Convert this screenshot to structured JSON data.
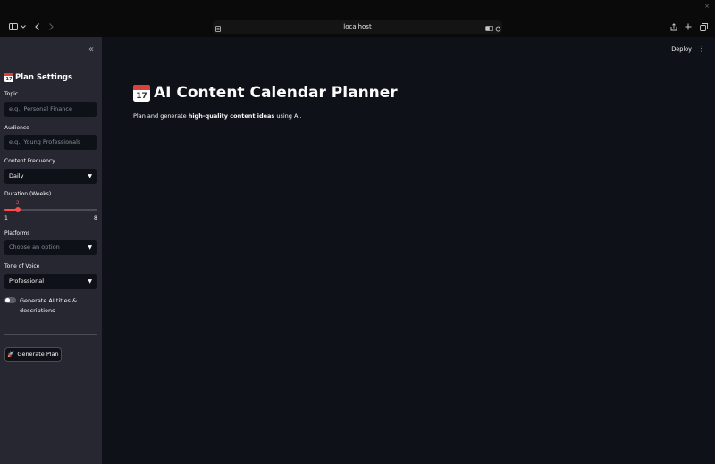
{
  "browser": {
    "url": "localhost",
    "close_glyph": "×"
  },
  "sidebar": {
    "title_emoji_day": "17",
    "title": "Plan Settings",
    "collapse_glyph": "«",
    "topic": {
      "label": "Topic",
      "placeholder": "e.g., Personal Finance"
    },
    "audience": {
      "label": "Audience",
      "placeholder": "e.g., Young Professionals"
    },
    "frequency": {
      "label": "Content Frequency",
      "value": "Daily"
    },
    "duration": {
      "label": "Duration (Weeks)",
      "value": "2",
      "min": "1",
      "max": "8",
      "fraction": 0.142857
    },
    "platforms": {
      "label": "Platforms",
      "placeholder": "Choose an option"
    },
    "tone": {
      "label": "Tone of Voice",
      "value": "Professional"
    },
    "toggle": {
      "label": "Generate AI titles & descriptions",
      "on": false
    },
    "generate_button": {
      "emoji": "🚀",
      "label": "Generate Plan"
    }
  },
  "header": {
    "deploy_label": "Deploy",
    "menu_glyph": "⋮"
  },
  "main": {
    "title_emoji_day": "17",
    "title": "AI Content Calendar Planner",
    "subtitle_prefix": "Plan and generate ",
    "subtitle_bold": "high-quality content ideas",
    "subtitle_suffix": " using AI."
  },
  "colors": {
    "accent": "#ff4b4b",
    "sidebar_bg": "#262730",
    "main_bg": "#0e1117"
  }
}
